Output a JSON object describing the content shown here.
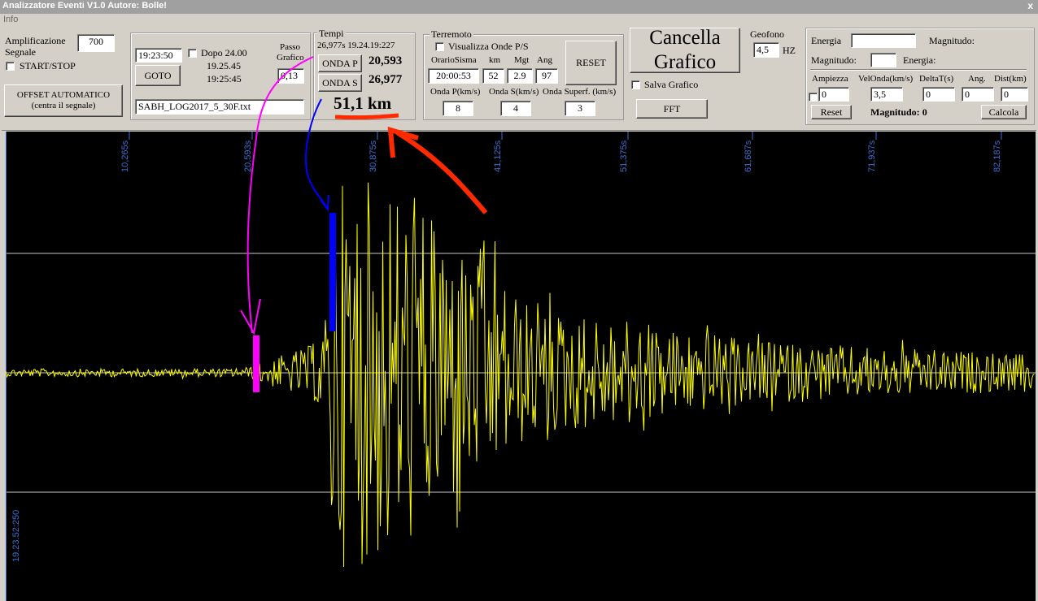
{
  "window": {
    "title": "Analizzatore Eventi V1.0  Autore: Bolle!",
    "close_glyph": "x"
  },
  "menu": {
    "info": "Info"
  },
  "amplification": {
    "label_line1": "Amplificazione",
    "label_line2": "Segnale",
    "value": "700",
    "start_stop": "START/STOP",
    "offset_line1": "OFFSET AUTOMATICO",
    "offset_line2": "(centra il segnale)"
  },
  "goto_panel": {
    "time_value": "19:23:50",
    "dopo_label": "Dopo 24.00",
    "time1": "19.25.45",
    "time2": "19:25:45",
    "goto_label": "GOTO",
    "passo_label_line1": "Passo",
    "passo_label_line2": "Grafico",
    "passo_value": "0,13",
    "filename": "SABH_LOG2017_5_30F.txt"
  },
  "tempi": {
    "title": "Tempi",
    "info_line": "26,977s 19.24.19:227",
    "onda_p_label": "ONDA P",
    "onda_p_value": "20,593",
    "onda_s_label": "ONDA S",
    "onda_s_value": "26,977",
    "distance_annotation": "51,1 km"
  },
  "terremoto": {
    "title": "Terremoto",
    "visualizza_label": "Visualizza Onde P/S",
    "col_orario": "OrarioSisma",
    "col_km": "km",
    "col_mgt": "Mgt",
    "col_ang": "Ang",
    "orario_value": "20:00:53",
    "km_value": "52",
    "mgt_value": "2.9",
    "ang_value": "97",
    "reset_label": "RESET",
    "onda_p_kms_label": "Onda P(km/s)",
    "onda_s_kms_label": "Onda S(km/s)",
    "onda_superf_label": "Onda Superf. (km/s)",
    "onda_p_kms_value": "8",
    "onda_s_kms_value": "4",
    "onda_superf_value": "3"
  },
  "cancella": {
    "line1": "Cancella",
    "line2": "Grafico",
    "salva_label": "Salva Grafico",
    "fft_label": "FFT"
  },
  "geofono": {
    "label": "Geofono",
    "value": "4,5",
    "unit": "HZ"
  },
  "energy_panel": {
    "energia_label": "Energia",
    "magnitudo_label": "Magnitudo:",
    "magnitudo_label2": "Magnitudo:",
    "energia_label2": "Energia:",
    "col_ampiezza": "Ampiezza",
    "col_velonda": "VelOnda(km/s)",
    "col_deltat": "DeltaT(s)",
    "col_ang": "Ang.",
    "col_dist": "Dist(km)",
    "ampiezza_value": "0",
    "velonda_value": "3,5",
    "deltat_value": "0",
    "ang_value": "0",
    "dist_value": "0",
    "reset_label": "Reset",
    "magnitudo_result_label": "Magnitudo:",
    "magnitudo_result_value": "0",
    "calcola_label": "Calcola"
  },
  "plot": {
    "time_marks": [
      "10,265s",
      "20,593s",
      "30,875s",
      "41,125s",
      "51,375s",
      "61,687s",
      "71,937s",
      "82,187s"
    ],
    "y_timestamp": "19.23.52:250",
    "colors": {
      "background": "#000000",
      "signal": "#ffff00",
      "grid": "#c8c8c8",
      "tick_text": "#3a6fd0",
      "p_marker": "#ff00ff",
      "s_marker": "#0000ff",
      "annotation": "#ff2a00"
    }
  }
}
